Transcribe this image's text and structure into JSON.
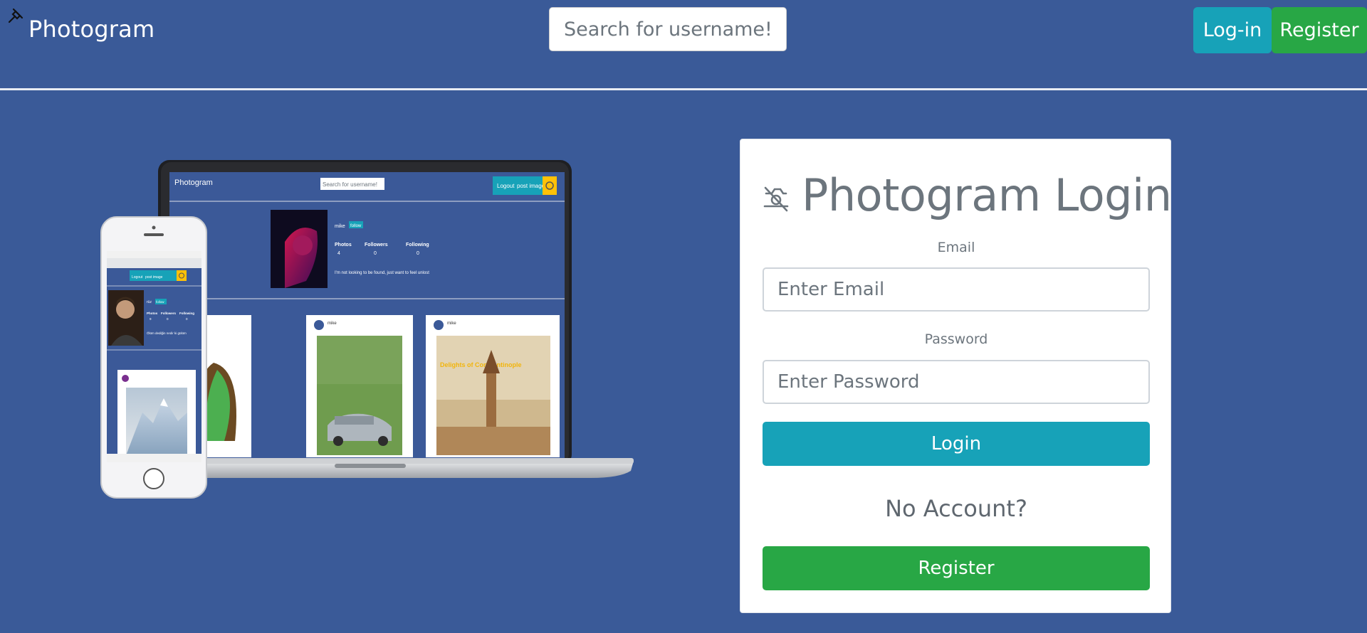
{
  "navbar": {
    "brand": "Photogram",
    "search_placeholder": "Search for username!",
    "login_label": "Log-in",
    "register_label": "Register"
  },
  "hero": {
    "laptop": {
      "brand": "Photogram",
      "search_placeholder": "Search for username!",
      "logout_label": "Logout",
      "post_image_label": "post image",
      "username": "mike",
      "follow_label": "follow",
      "stats": [
        {
          "label": "Photos",
          "value": "4"
        },
        {
          "label": "Followers",
          "value": "0"
        },
        {
          "label": "Following",
          "value": "0"
        }
      ],
      "bio": "I'm not looking to be found, just want to feel unlost",
      "posts": [
        {
          "user": "mike"
        },
        {
          "user": "mike",
          "caption": "Delights of Constantinople"
        }
      ]
    },
    "phone": {
      "logout_label": "Logout",
      "post_image_label": "post image",
      "username": "rüz",
      "follow_label": "follow",
      "stats": [
        {
          "label": "Photos",
          "value": "9"
        },
        {
          "label": "Followers",
          "value": "0"
        },
        {
          "label": "Following",
          "value": "0"
        }
      ],
      "bio": "Ölüm dediğin nedir ki gülüm"
    }
  },
  "login_card": {
    "title": "Photogram Login",
    "email_label": "Email",
    "email_placeholder": "Enter Email",
    "password_label": "Password",
    "password_placeholder": "Enter Password",
    "login_button": "Login",
    "no_account": "No Account?",
    "register_button": "Register"
  },
  "colors": {
    "background": "#3a5a98",
    "info": "#17a2b8",
    "success": "#28a745",
    "muted": "#6c757d"
  }
}
